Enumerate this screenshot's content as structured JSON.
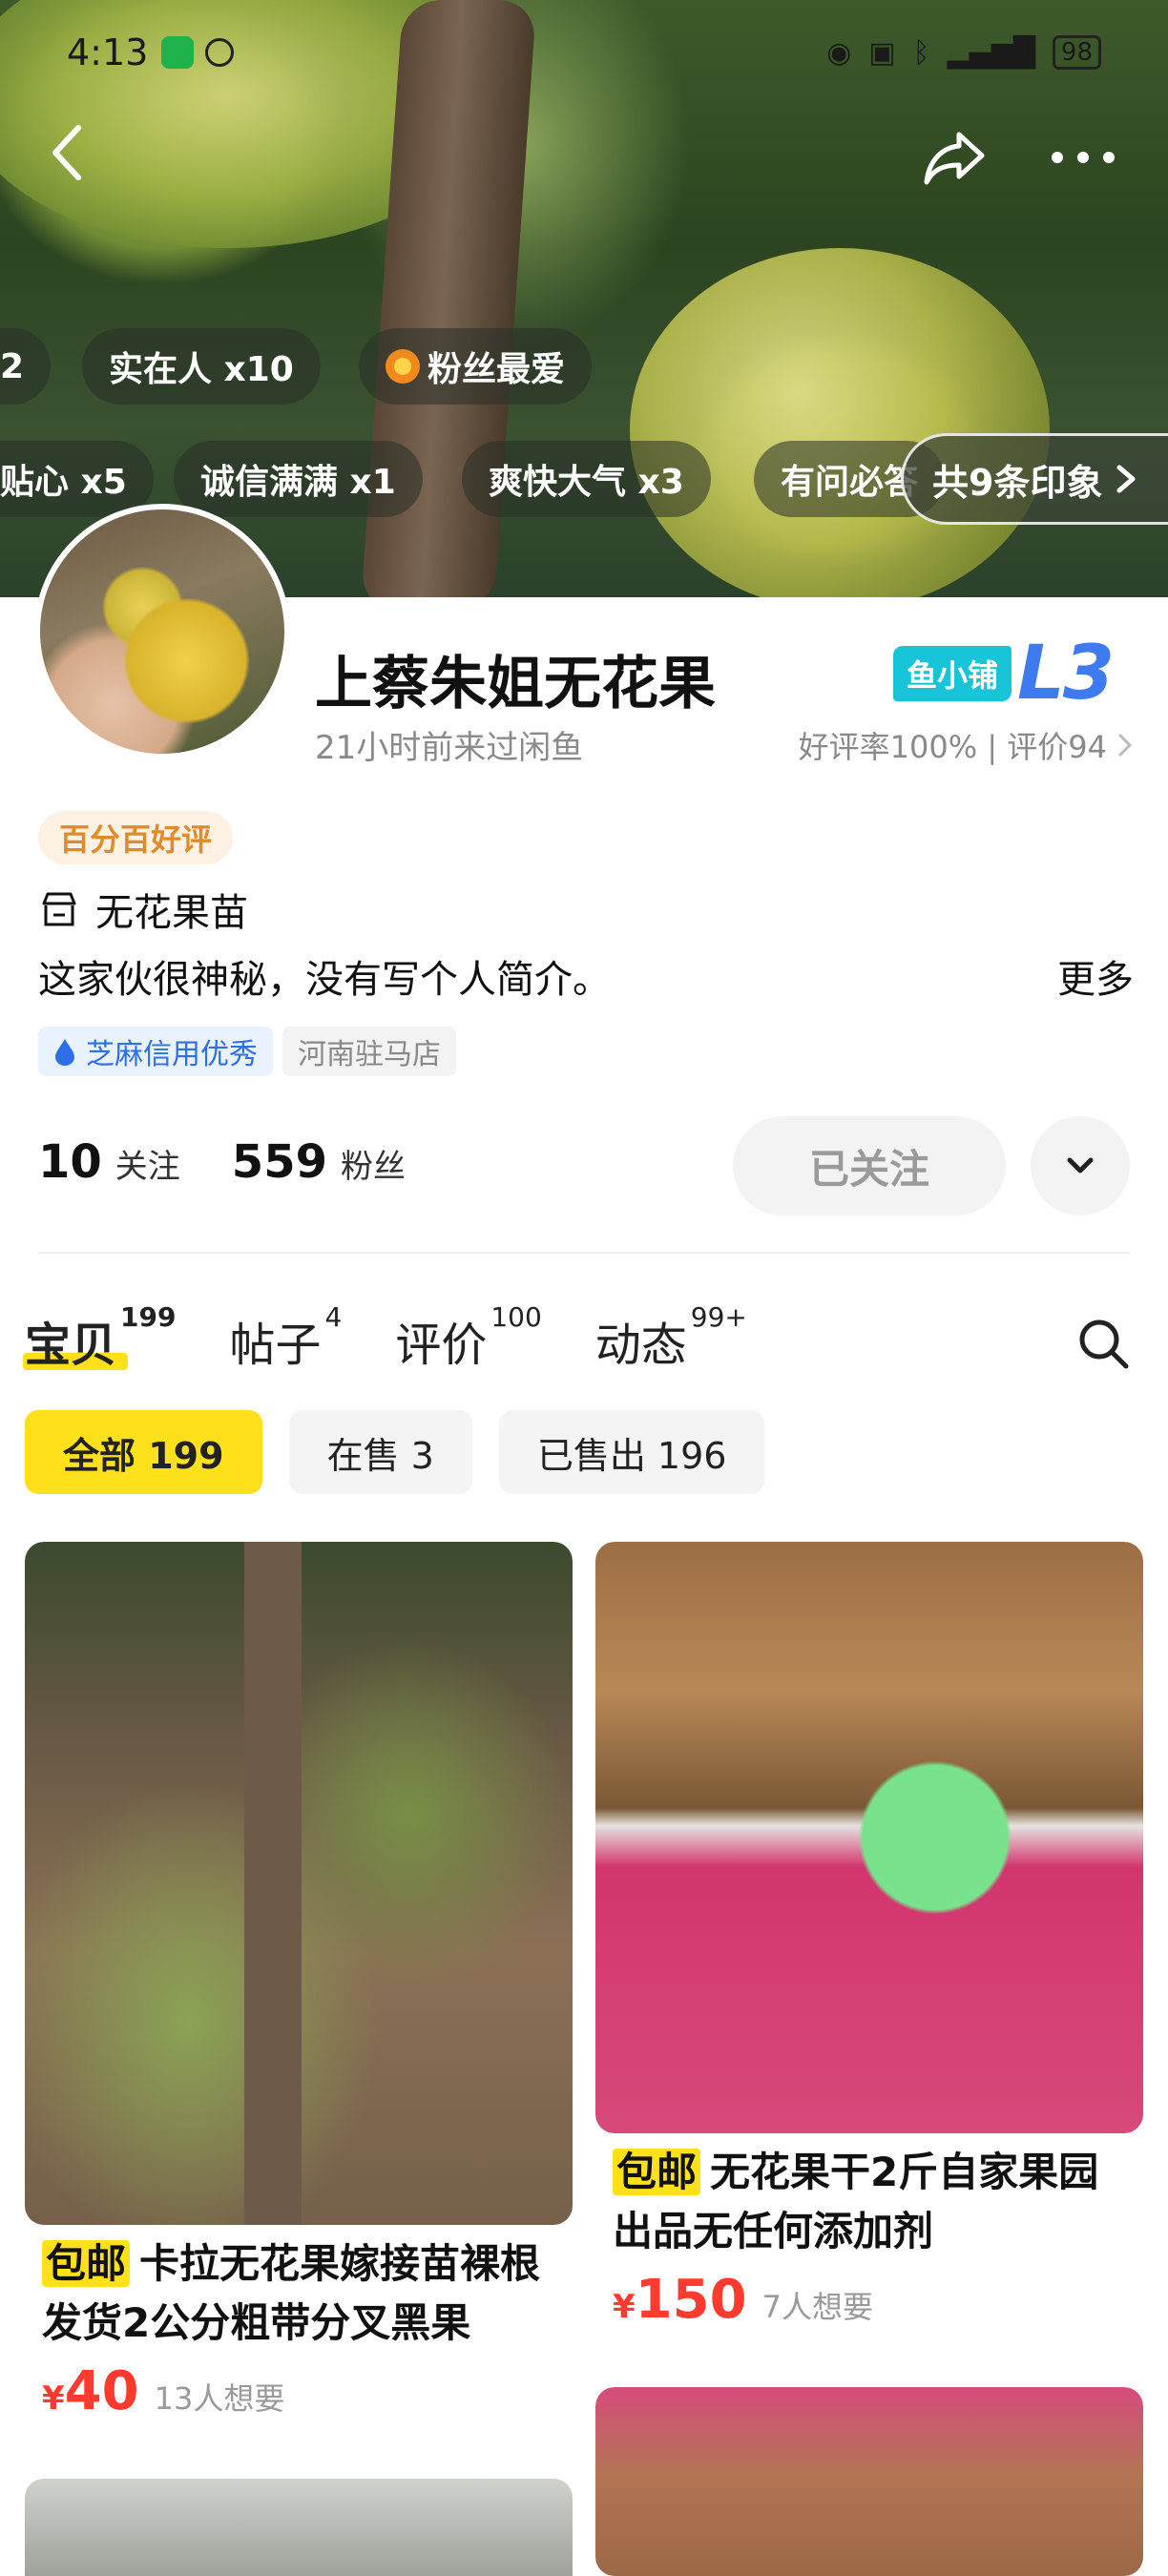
{
  "status_bar": {
    "time": "4:13",
    "battery": "98"
  },
  "banner": {
    "chips_row1": [
      "2",
      "实在人 x10",
      "粉丝最爱"
    ],
    "chips_row2": [
      "贴心 x5",
      "诚信满满 x1",
      "爽快大气 x3",
      "有问必答"
    ],
    "impressions": "共9条印象"
  },
  "profile": {
    "shop_name": "上蔡朱姐无花果",
    "last_seen": "21小时前来过闲鱼",
    "badge_prefix": "鱼小铺",
    "level": "L3",
    "rating": "好评率100% | 评价94",
    "good_tag": "百分百好评",
    "category": "无花果苗",
    "bio": "这家伙很神秘，没有写个人简介。",
    "more": "更多",
    "credit": "芝麻信用优秀",
    "location": "河南驻马店",
    "following_count": "10",
    "following_label": "关注",
    "fans_count": "559",
    "fans_label": "粉丝",
    "follow_button": "已关注"
  },
  "tabs": [
    {
      "label": "宝贝",
      "count": "199"
    },
    {
      "label": "帖子",
      "count": "4"
    },
    {
      "label": "评价",
      "count": "100"
    },
    {
      "label": "动态",
      "count": "99+"
    }
  ],
  "filters": [
    "全部 199",
    "在售 3",
    "已售出 196"
  ],
  "items": [
    {
      "tag": "包邮",
      "title": "卡拉无花果嫁接苗裸根发货2公分粗带分叉黑果",
      "yen": "¥",
      "price": "40",
      "want": "13人想要"
    },
    {
      "tag": "包邮",
      "title": "无花果干2斤自家果园出品无任何添加剂",
      "yen": "¥",
      "price": "150",
      "want": "7人想要"
    }
  ]
}
